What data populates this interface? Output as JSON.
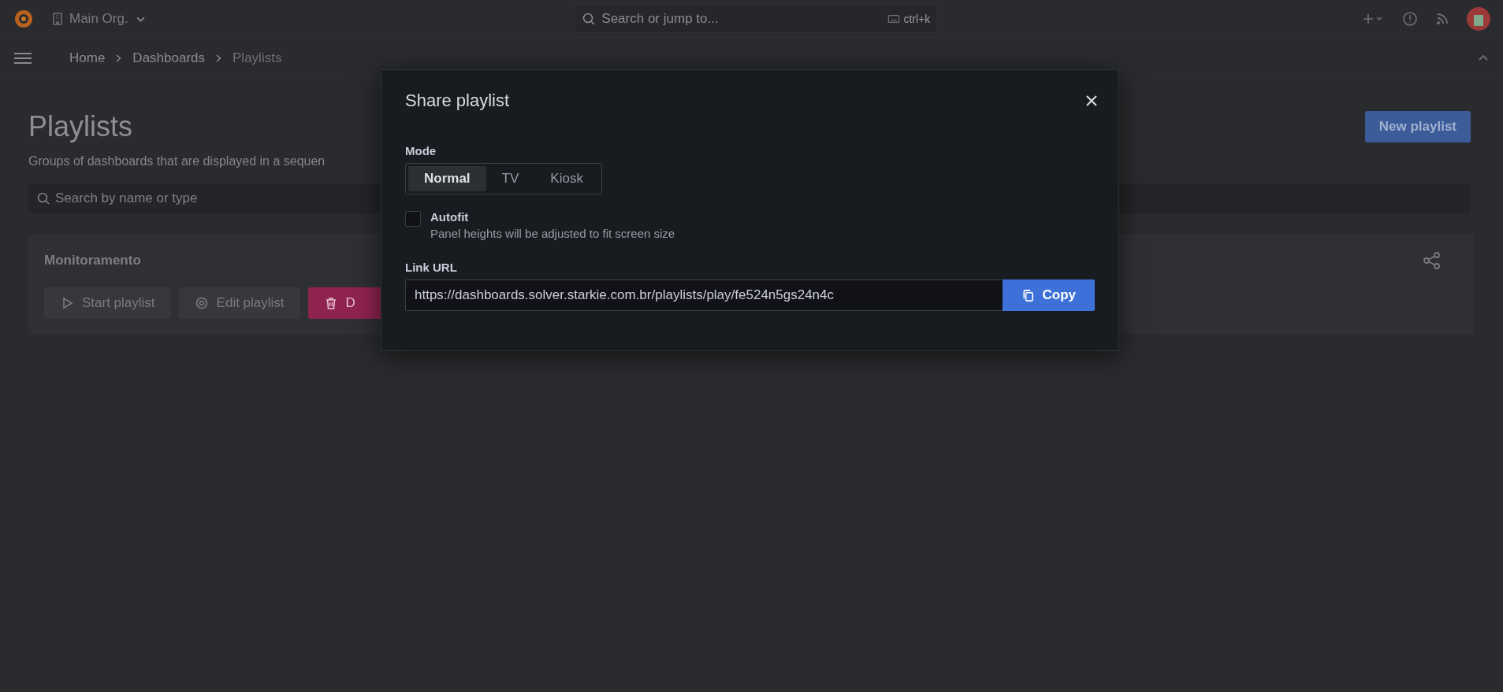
{
  "top_bar": {
    "org": "Main Org.",
    "search": {
      "placeholder": "Search or jump to..."
    },
    "shortcut": "ctrl+k"
  },
  "breadcrumbs": [
    {
      "label": "Home",
      "selected": false
    },
    {
      "label": "Dashboards",
      "selected": false
    },
    {
      "label": "Playlists",
      "selected": true
    }
  ],
  "page": {
    "title": "Playlists",
    "subtitle": "Groups of dashboards that are displayed in a sequen",
    "new_button": "New playlist",
    "search": {
      "placeholder": "Search by name or type"
    },
    "playlists": [
      {
        "name": "Monitoramento",
        "buttons": [
          {
            "kind": "start",
            "label": "Start playlist"
          },
          {
            "kind": "edit",
            "label": "Edit playlist"
          },
          {
            "kind": "delete",
            "label": "D"
          }
        ]
      }
    ]
  },
  "modal": {
    "title": "Share playlist",
    "mode_label": "Mode",
    "modes": [
      {
        "label": "Normal",
        "selected": true
      },
      {
        "label": "TV",
        "selected": false
      },
      {
        "label": "Kiosk",
        "selected": false
      }
    ],
    "autofit": {
      "label": "Autofit",
      "description": "Panel heights will be adjusted to fit screen size",
      "checked": false
    },
    "link_label": "Link URL",
    "link": "https://dashboards.solver.starkie.com.br/playlists/play/fe524n5gs24n4c",
    "copy_button": "Copy"
  }
}
